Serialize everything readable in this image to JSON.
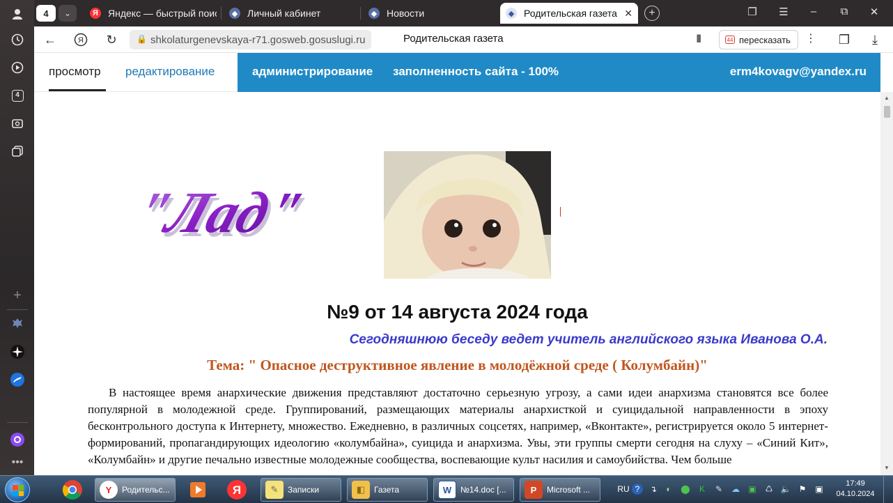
{
  "browser": {
    "tab_count": "4",
    "tabs": [
      {
        "title": "Яндекс — быстрый поиск"
      },
      {
        "title": "Личный кабинет"
      },
      {
        "title": "Новости"
      },
      {
        "title": "Родительская газета"
      }
    ],
    "url_host": "shkolaturgenevskaya-r71.gosweb.gosuslugi.ru",
    "page_title": "Родительская газета",
    "summarize_label": "пересказать"
  },
  "adminbar": {
    "view": "просмотр",
    "edit": "редактирование",
    "admin": "администрирование",
    "fill": "заполненность сайта - 100%",
    "user": "erm4kovagv@yandex.ru"
  },
  "newspaper": {
    "logo_text": "\"Лад\"",
    "issue_title": "№9 от 14 августа 2024 года",
    "lead": "Сегодняшнюю беседу ведет  учитель английского языка Иванова О.А.",
    "topic": "Тема:  \" Опасное  деструктивное явление в молодёжной среде ( Колумбайн)\"",
    "article": "В настоящее время  анархические движения представляют достаточно серьезную угрозу, а сами идеи анархизма становятся все более популярной в молодежной среде. Группирований, размещающих материалы анархисткой и суицидальной направленности в эпоху бесконтрольного доступа к Интернету, множество. Ежедневно, в различных соцсетях, например, «Вконтакте», регистрируется около 5 интернет-формирований, пропагандирующих идеологию «колумбайна», суицида и анархизма. Увы, эти группы смерти сегодня на слуху – «Синий Кит», «Колумбайн» и другие печально известные молодежные сообщества, воспевающие культ насилия и самоубийства. Чем больше"
  },
  "taskbar": {
    "apps": [
      {
        "label": "Родительс..."
      },
      {
        "label": "Записки"
      },
      {
        "label": "Газета"
      },
      {
        "label": "№14.doc [..."
      },
      {
        "label": "Microsoft ..."
      }
    ],
    "lang": "RU",
    "time": "17:49",
    "date": "04.10.2024"
  },
  "colors": {
    "admin_blue": "#1f8ac6",
    "lead_blue": "#3a3acb",
    "topic_orange": "#c0561e"
  }
}
